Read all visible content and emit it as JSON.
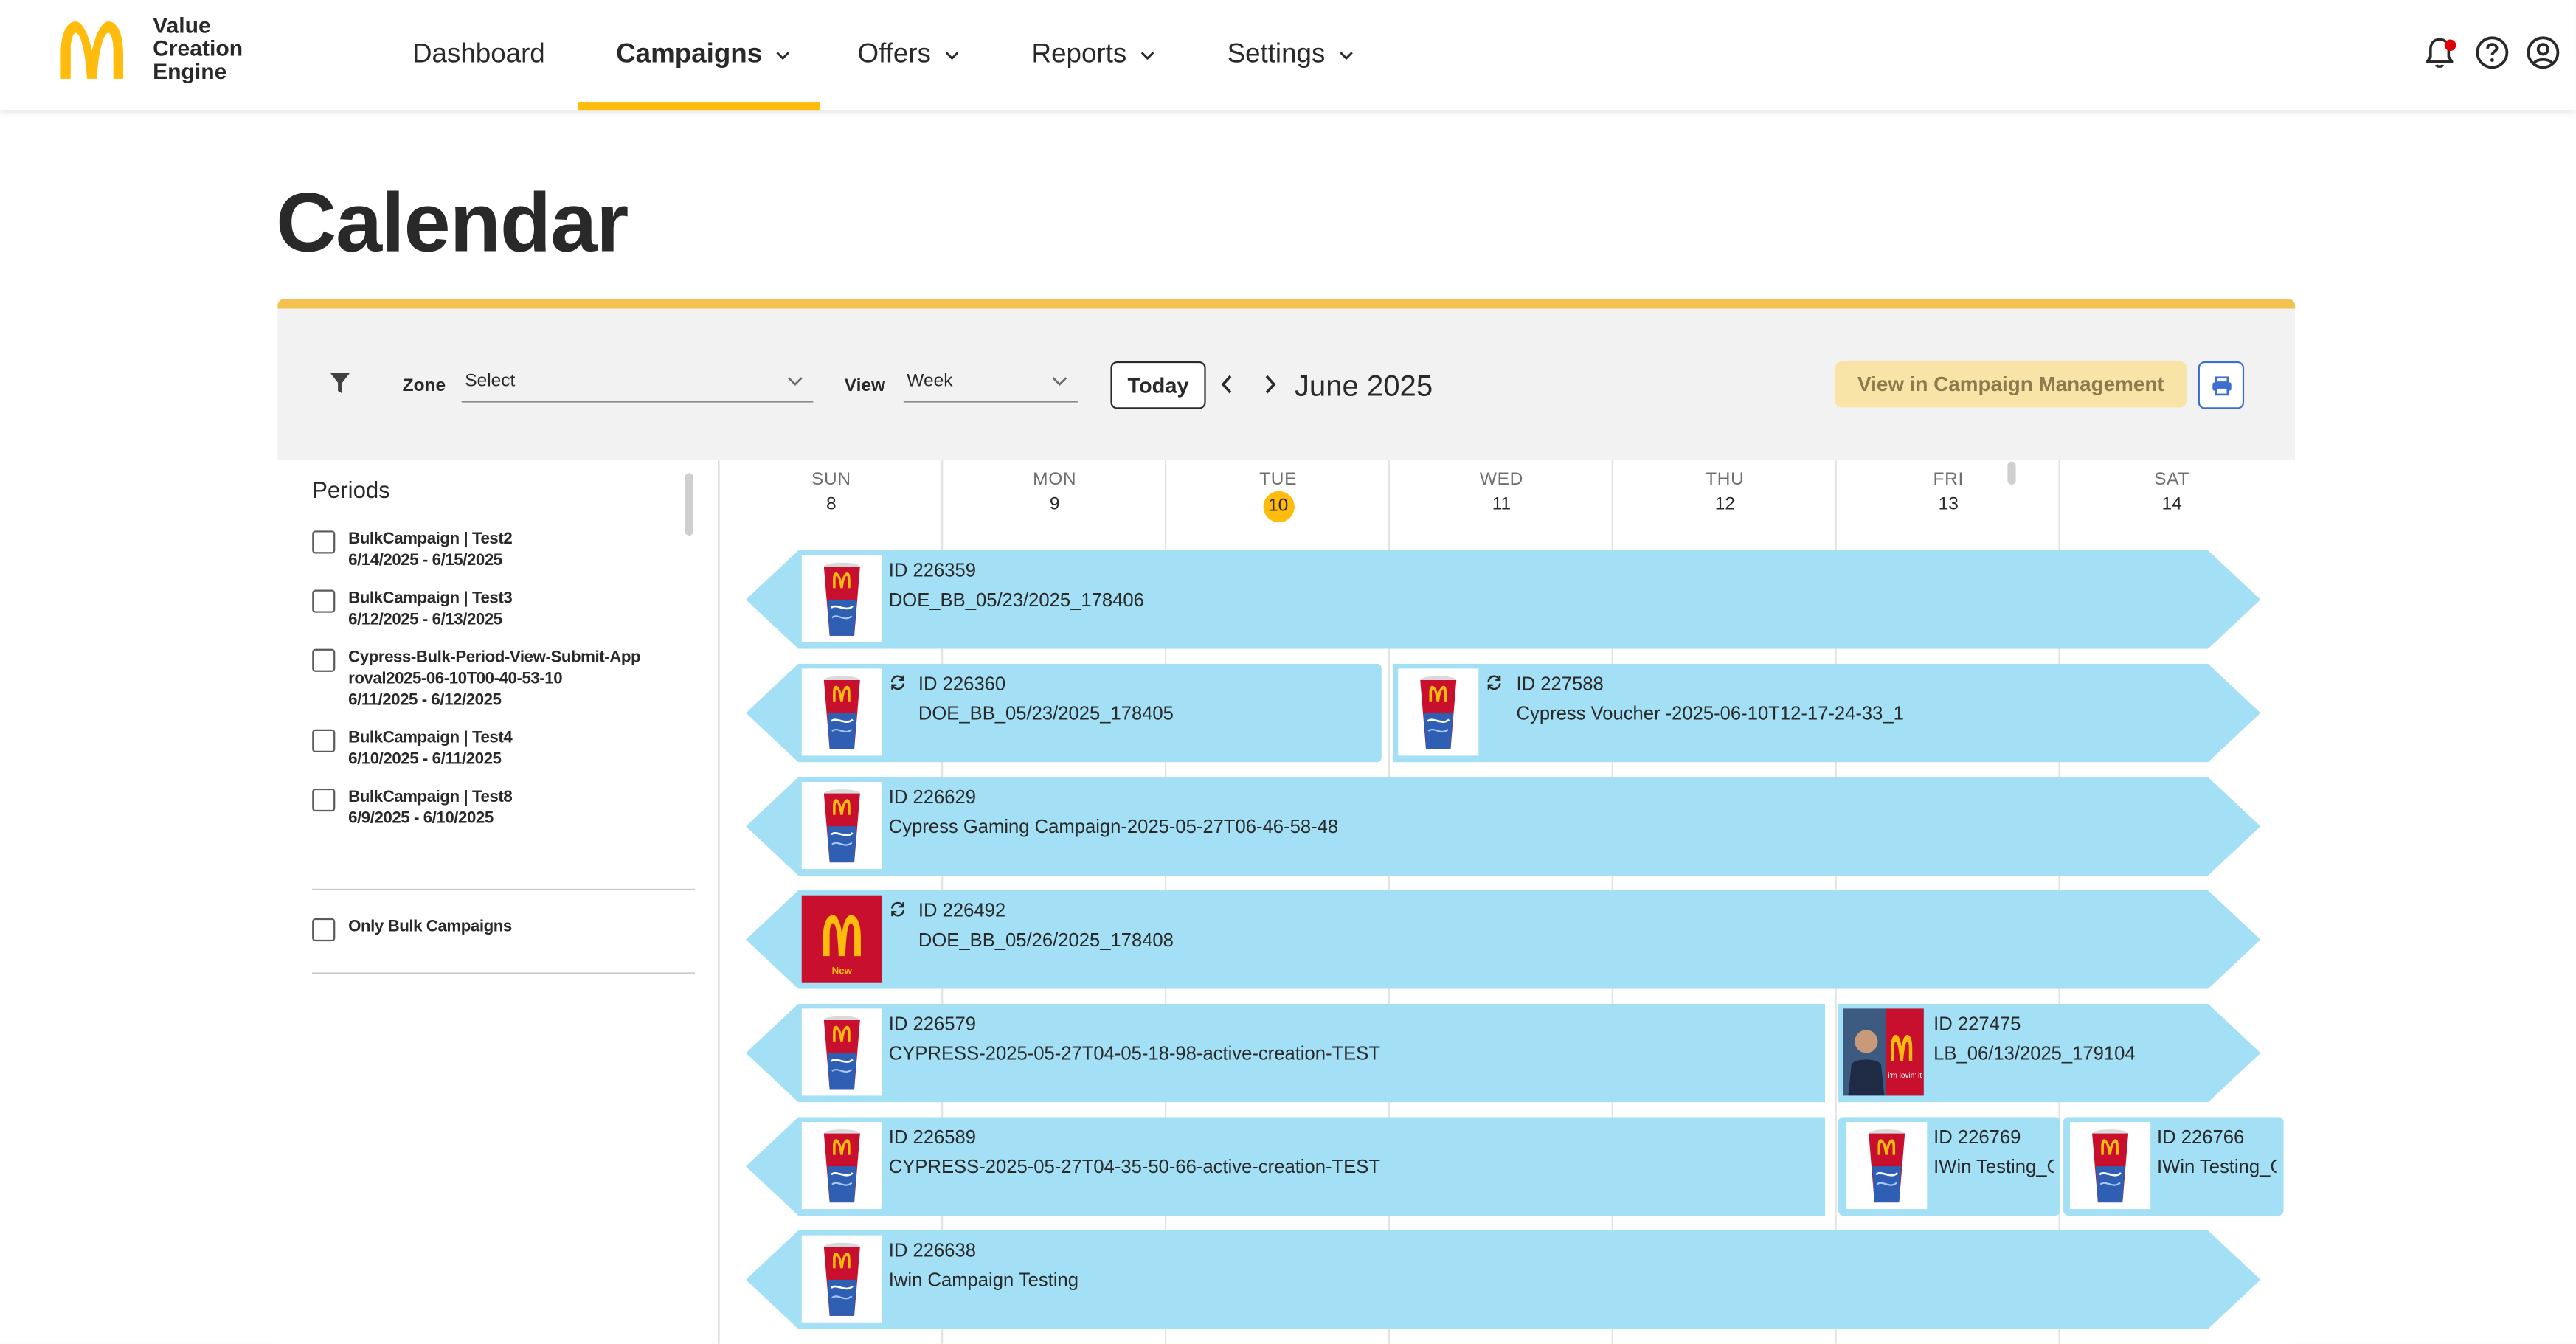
{
  "brand": {
    "line1": "Value",
    "line2": "Creation",
    "line3": "Engine",
    "accent_color": "#ffbc0d",
    "logo_color": "#ffbc0d"
  },
  "nav": {
    "dashboard": "Dashboard",
    "campaigns": "Campaigns",
    "offers": "Offers",
    "reports": "Reports",
    "settings": "Settings",
    "active": "Campaigns"
  },
  "header_icons": [
    "bell-icon",
    "help-icon",
    "account-icon"
  ],
  "page": {
    "title": "Calendar"
  },
  "toolbar": {
    "zone_label": "Zone",
    "zone_value": "Select",
    "view_label": "View",
    "view_value": "Week",
    "today_label": "Today",
    "month": "June 2025",
    "view_in_cm_label": "View in Campaign Management"
  },
  "periods": {
    "title": "Periods",
    "items": [
      {
        "name": "BulkCampaign | Test2",
        "dates": "6/14/2025 - 6/15/2025"
      },
      {
        "name": "BulkCampaign | Test3",
        "dates": "6/12/2025 - 6/13/2025"
      },
      {
        "name": "Cypress-Bulk-Period-View-Submit-Approval2025-06-10T00-40-53-10",
        "dates": "6/11/2025 - 6/12/2025"
      },
      {
        "name": "BulkCampaign | Test4",
        "dates": "6/10/2025 - 6/11/2025"
      },
      {
        "name": "BulkCampaign | Test8",
        "dates": "6/9/2025 - 6/10/2025"
      }
    ],
    "only_bulk_label": "Only Bulk Campaigns"
  },
  "week": {
    "days": [
      {
        "name": "SUN",
        "num": "8"
      },
      {
        "name": "MON",
        "num": "9"
      },
      {
        "name": "TUE",
        "num": "10",
        "today": true
      },
      {
        "name": "WED",
        "num": "11"
      },
      {
        "name": "THU",
        "num": "12"
      },
      {
        "name": "FRI",
        "num": "13"
      },
      {
        "name": "SAT",
        "num": "14"
      }
    ],
    "bar_color": "#a3dff5"
  },
  "campaigns": [
    {
      "id": "ID 226359",
      "name": "DOE_BB_05/23/2025_178406",
      "recurring": false,
      "thumb": "cup"
    },
    {
      "id": "ID 226360",
      "name": "DOE_BB_05/23/2025_178405",
      "recurring": true,
      "thumb": "cup"
    },
    {
      "id": "ID 227588",
      "name": "Cypress Voucher -2025-06-10T12-17-24-33_1",
      "recurring": true,
      "thumb": "cup"
    },
    {
      "id": "ID 226629",
      "name": "Cypress Gaming Campaign-2025-05-27T06-46-58-48",
      "recurring": false,
      "thumb": "cup"
    },
    {
      "id": "ID 226492",
      "name": "DOE_BB_05/26/2025_178408",
      "recurring": true,
      "thumb": "logo-new",
      "thumb_caption": "New"
    },
    {
      "id": "ID 226579",
      "name": "CYPRESS-2025-05-27T04-05-18-98-active-creation-TEST",
      "recurring": false,
      "thumb": "cup"
    },
    {
      "id": "ID 227475",
      "name": "LB_06/13/2025_179104",
      "recurring": false,
      "thumb": "photo",
      "thumb_caption": "i'm lovin' it"
    },
    {
      "id": "ID 226589",
      "name": "CYPRESS-2025-05-27T04-35-50-66-active-creation-TEST",
      "recurring": false,
      "thumb": "cup"
    },
    {
      "id": "ID 226769",
      "name": "IWin Testing_C",
      "recurring": false,
      "thumb": "cup"
    },
    {
      "id": "ID 226766",
      "name": "IWin Testing_C",
      "recurring": false,
      "thumb": "cup"
    },
    {
      "id": "ID 226638",
      "name": "Iwin Campaign Testing",
      "recurring": false,
      "thumb": "cup"
    }
  ]
}
